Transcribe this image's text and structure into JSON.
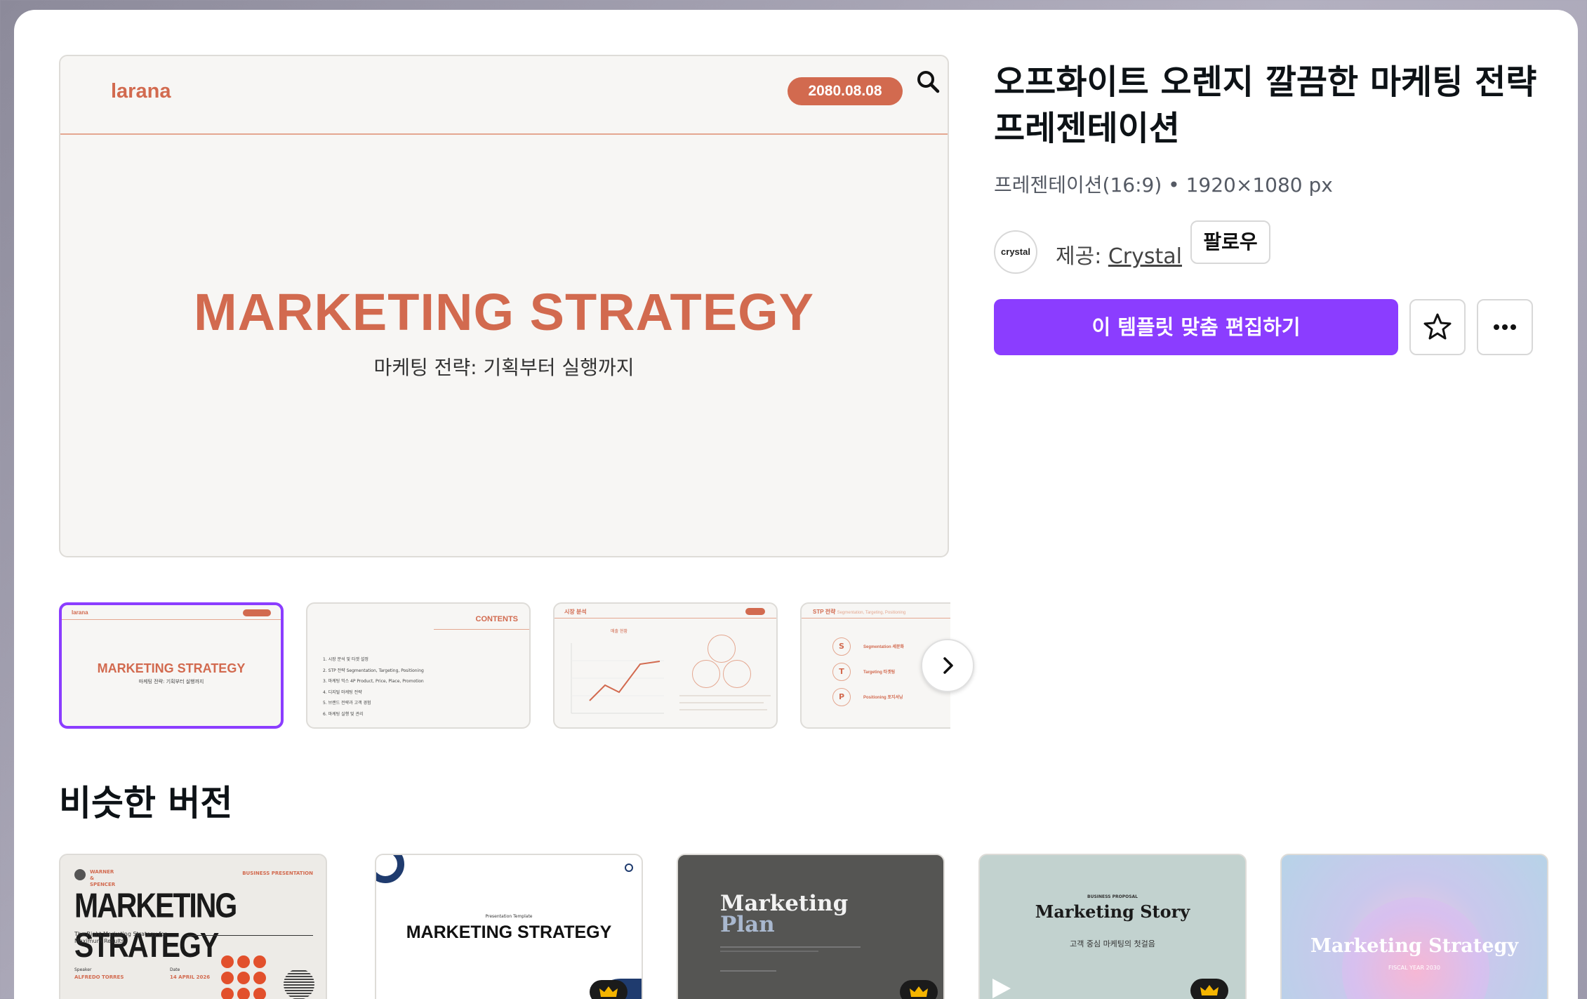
{
  "preview": {
    "brand": "larana",
    "date": "2080.08.08",
    "title": "MARKETING STRATEGY",
    "subtitle": "마케팅 전략: 기획부터 실행까지"
  },
  "thumbnails": [
    {
      "brand": "larana",
      "date": "2080.08.08",
      "title": "MARKETING STRATEGY",
      "subtitle": "마케팅 전략: 기획부터 실행까지"
    },
    {
      "heading": "CONTENTS",
      "items": [
        "1. 시장 분석 및 타겟 설정",
        "2. STP 전략  Segmentation, Targeting, Positioning",
        "3. 마케팅 믹스 4P  Product, Price, Place, Promotion",
        "4. 디지털 마케팅 전략",
        "5. 브랜드 전략과 고객 경험",
        "6. 마케팅 실행 및 관리"
      ]
    },
    {
      "heading": "시장 분석",
      "chart_title": "매출 현황",
      "bubbles": [
        "시장 세분화",
        "경쟁 분석",
        "시장 트렌드"
      ]
    },
    {
      "heading": "STP 전략",
      "tagline": "Segmentation, Targeting, Positioning",
      "rows": [
        {
          "letter": "S",
          "label": "Segmentation 세분화"
        },
        {
          "letter": "T",
          "label": "Targeting 타겟팅"
        },
        {
          "letter": "P",
          "label": "Positioning 포지셔닝"
        }
      ]
    }
  ],
  "info": {
    "title": "오프화이트 오렌지 깔끔한 마케팅 전략 프레젠테이션",
    "meta": "프레젠테이션(16:9) • 1920×1080 px",
    "avatar_text": "crystal",
    "provider_prefix": "제공: ",
    "provider_name": "Crystal",
    "follow_label": "팔로우",
    "cta_label": "이 템플릿 맞춤 편집하기"
  },
  "similar": {
    "heading": "비슷한 버전",
    "cards": [
      {
        "top_left": "WARNER & SPENCER",
        "top_right": "BUSINESS PRESENTATION",
        "title": "MARKETING STRATEGY",
        "subtitle": "The Right Marketing Strategy for Maximum Results",
        "speaker_label": "Speaker",
        "speaker": "ALFREDO TORRES",
        "date_label": "Date",
        "date": "14 APRIL 2026"
      },
      {
        "small": "Presentation Template",
        "title": "MARKETING STRATEGY"
      },
      {
        "title_1": "Marketing",
        "title_2": "Plan"
      },
      {
        "small": "BUSINESS PROPOSAL",
        "title": "Marketing Story",
        "subtitle": "고객 중심 마케팅의 첫걸음"
      },
      {
        "title": "Marketing Strategy",
        "subtitle": "FISCAL YEAR 2030"
      }
    ]
  },
  "colors": {
    "accent": "#8b3dff",
    "brand_orange": "#d26a4f"
  }
}
